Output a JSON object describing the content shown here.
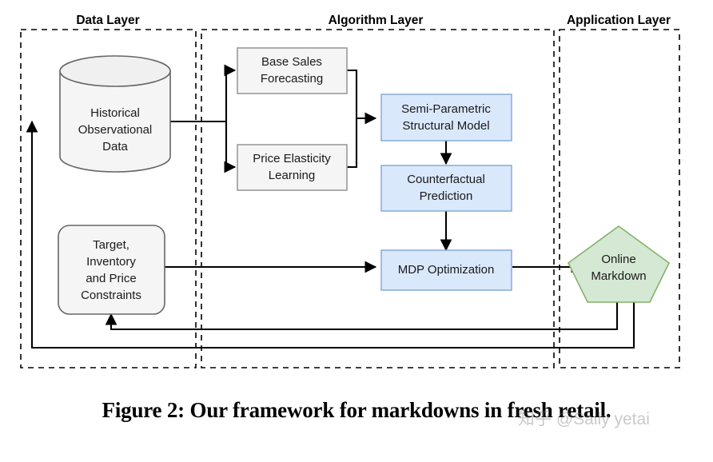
{
  "figure": {
    "caption": "Figure 2: Our framework for markdowns in fresh retail.",
    "watermark": "知乎 @Sally yetai"
  },
  "colors": {
    "gray_fill": "#f5f5f5",
    "gray_stroke": "#9a9a9a",
    "blue_fill": "#dae8fc",
    "blue_stroke": "#7ea6d8",
    "green_fill": "#d5e8d4",
    "green_stroke": "#82b366",
    "line": "#000000",
    "dashed_border": "#000000"
  },
  "layers": [
    {
      "id": "data-layer",
      "title": "Data Layer"
    },
    {
      "id": "algorithm-layer",
      "title": "Algorithm Layer"
    },
    {
      "id": "application-layer",
      "title": "Application Layer"
    }
  ],
  "nodes": [
    {
      "id": "historical-observational-data",
      "shape": "cylinder",
      "layer": "data-layer",
      "lines": [
        "Historical",
        "Observational",
        "Data"
      ]
    },
    {
      "id": "target-inventory-price-constraints",
      "shape": "rounded-rect",
      "layer": "data-layer",
      "lines": [
        "Target,",
        "Inventory",
        "and Price",
        "Constraints"
      ]
    },
    {
      "id": "base-sales-forecasting",
      "shape": "rect",
      "layer": "algorithm-layer",
      "lines": [
        "Base Sales",
        "Forecasting"
      ]
    },
    {
      "id": "price-elasticity-learning",
      "shape": "rect",
      "layer": "algorithm-layer",
      "lines": [
        "Price Elasticity",
        "Learning"
      ]
    },
    {
      "id": "semi-parametric-structural-model",
      "shape": "rect",
      "layer": "algorithm-layer",
      "lines": [
        "Semi-Parametric",
        "Structural Model"
      ]
    },
    {
      "id": "counterfactual-prediction",
      "shape": "rect",
      "layer": "algorithm-layer",
      "lines": [
        "Counterfactual",
        "Prediction"
      ]
    },
    {
      "id": "mdp-optimization",
      "shape": "rect",
      "layer": "algorithm-layer",
      "lines": [
        "MDP Optimization"
      ]
    },
    {
      "id": "online-markdown",
      "shape": "pentagon",
      "layer": "application-layer",
      "lines": [
        "Online",
        "Markdown"
      ]
    }
  ],
  "edges": [
    {
      "from": "historical-observational-data",
      "to": "base-sales-forecasting"
    },
    {
      "from": "historical-observational-data",
      "to": "price-elasticity-learning"
    },
    {
      "from": "base-sales-forecasting",
      "to": "semi-parametric-structural-model"
    },
    {
      "from": "price-elasticity-learning",
      "to": "semi-parametric-structural-model"
    },
    {
      "from": "semi-parametric-structural-model",
      "to": "counterfactual-prediction"
    },
    {
      "from": "counterfactual-prediction",
      "to": "mdp-optimization"
    },
    {
      "from": "target-inventory-price-constraints",
      "to": "mdp-optimization"
    },
    {
      "from": "mdp-optimization",
      "to": "online-markdown"
    },
    {
      "from": "online-markdown",
      "to": "target-inventory-price-constraints"
    },
    {
      "from": "online-markdown",
      "to": "historical-observational-data"
    }
  ]
}
